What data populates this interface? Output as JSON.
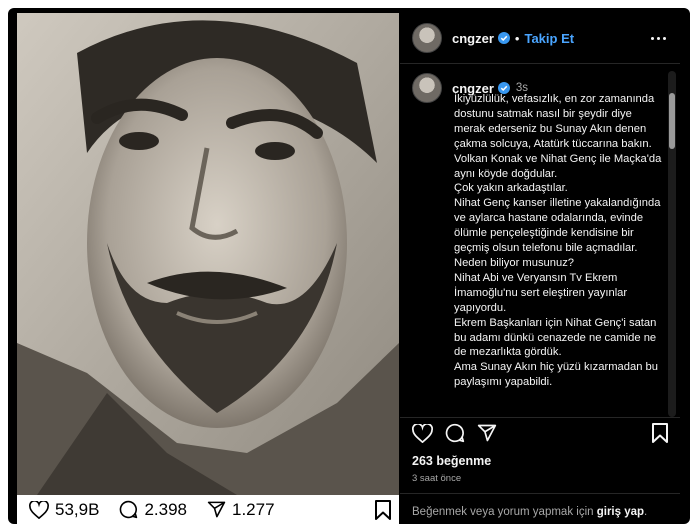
{
  "photo": {
    "alt": ""
  },
  "photo_stats": {
    "likes": "53,9B",
    "comments": "2.398",
    "shares": "1.277"
  },
  "header": {
    "username": "cngzer",
    "separator": "•",
    "follow_label": "Takip Et"
  },
  "caption": {
    "username": "cngzer",
    "time": "3s",
    "text": "İkiyüzlülük, vefasızlık, en zor zamanında dostunu satmak nasıl bir şeydir diye merak ederseniz bu Sunay Akın denen çakma solcuya, Atatürk tüccarına bakın.\nVolkan Konak ve Nihat Genç ile Maçka'da aynı köyde doğdular.\nÇok yakın arkadaştılar.\nNihat Genç kanser illetine yakalandığında ve aylarca hastane odalarında, evinde ölümle pençeleştiğinde kendisine bir geçmiş olsun telefonu bile açmadılar.\nNeden biliyor musunuz?\nNihat Abi ve Veryansın Tv Ekrem İmamoğlu'nu sert eleştiren yayınlar yapıyordu.\nEkrem Başkanları için Nihat Genç'i satan bu adamı dünkü cenazede ne camide ne de mezarlıkta gördük.\nAma Sunay Akın hiç yüzü kızarmadan bu paylaşımı yapabildi."
  },
  "footer": {
    "likes": "263 beğenme",
    "ago": "3 saat önce",
    "login_prefix": "Beğenmek veya yorum yapmak için ",
    "login_link": "giriş yap",
    "login_suffix": "."
  },
  "colors": {
    "follow": "#4aa5ff",
    "verified": "#3897f0",
    "panel_bg": "#000000"
  },
  "icons": [
    "heart-icon",
    "comment-icon",
    "share-icon",
    "bookmark-icon",
    "verified-icon",
    "more-icon"
  ]
}
